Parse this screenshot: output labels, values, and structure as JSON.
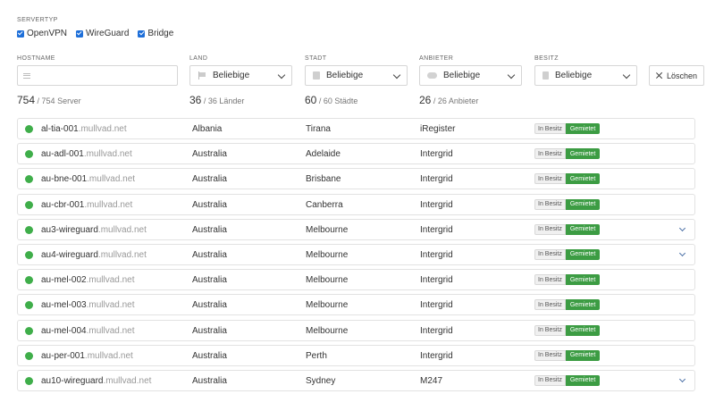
{
  "filters": {
    "servertyp_label": "SERVERTYP",
    "types": [
      {
        "label": "OpenVPN",
        "checked": true
      },
      {
        "label": "WireGuard",
        "checked": true
      },
      {
        "label": "Bridge",
        "checked": true
      }
    ],
    "hostname_label": "HOSTNAME",
    "hostname_value": "",
    "land_label": "LAND",
    "land_value": "Beliebige",
    "stadt_label": "STADT",
    "stadt_value": "Beliebige",
    "anbieter_label": "ANBIETER",
    "anbieter_value": "Beliebige",
    "besitz_label": "BESITZ",
    "besitz_value": "Beliebige",
    "delete_label": "Löschen"
  },
  "counts": {
    "server": {
      "shown": "754",
      "rest": "/ 754 Server"
    },
    "laender": {
      "shown": "36",
      "rest": "/ 36 Länder"
    },
    "staedte": {
      "shown": "60",
      "rest": "/ 60 Städte"
    },
    "anbieter": {
      "shown": "26",
      "rest": "/ 26 Anbieter"
    }
  },
  "badges": {
    "own": "In Besitz",
    "rent": "Gemietet"
  },
  "colors": {
    "status_online": "#3fae4a",
    "badge_rented": "#3c9c43",
    "checkbox": "#1e6fd9"
  },
  "servers": [
    {
      "host": "al-tia-001",
      "domain": ".mullvad.net",
      "country": "Albania",
      "city": "Tirana",
      "provider": "iRegister",
      "expandable": false
    },
    {
      "host": "au-adl-001",
      "domain": ".mullvad.net",
      "country": "Australia",
      "city": "Adelaide",
      "provider": "Intergrid",
      "expandable": false
    },
    {
      "host": "au-bne-001",
      "domain": ".mullvad.net",
      "country": "Australia",
      "city": "Brisbane",
      "provider": "Intergrid",
      "expandable": false
    },
    {
      "host": "au-cbr-001",
      "domain": ".mullvad.net",
      "country": "Australia",
      "city": "Canberra",
      "provider": "Intergrid",
      "expandable": false
    },
    {
      "host": "au3-wireguard",
      "domain": ".mullvad.net",
      "country": "Australia",
      "city": "Melbourne",
      "provider": "Intergrid",
      "expandable": true
    },
    {
      "host": "au4-wireguard",
      "domain": ".mullvad.net",
      "country": "Australia",
      "city": "Melbourne",
      "provider": "Intergrid",
      "expandable": true
    },
    {
      "host": "au-mel-002",
      "domain": ".mullvad.net",
      "country": "Australia",
      "city": "Melbourne",
      "provider": "Intergrid",
      "expandable": false
    },
    {
      "host": "au-mel-003",
      "domain": ".mullvad.net",
      "country": "Australia",
      "city": "Melbourne",
      "provider": "Intergrid",
      "expandable": false
    },
    {
      "host": "au-mel-004",
      "domain": ".mullvad.net",
      "country": "Australia",
      "city": "Melbourne",
      "provider": "Intergrid",
      "expandable": false
    },
    {
      "host": "au-per-001",
      "domain": ".mullvad.net",
      "country": "Australia",
      "city": "Perth",
      "provider": "Intergrid",
      "expandable": false
    },
    {
      "host": "au10-wireguard",
      "domain": ".mullvad.net",
      "country": "Australia",
      "city": "Sydney",
      "provider": "M247",
      "expandable": true
    }
  ]
}
